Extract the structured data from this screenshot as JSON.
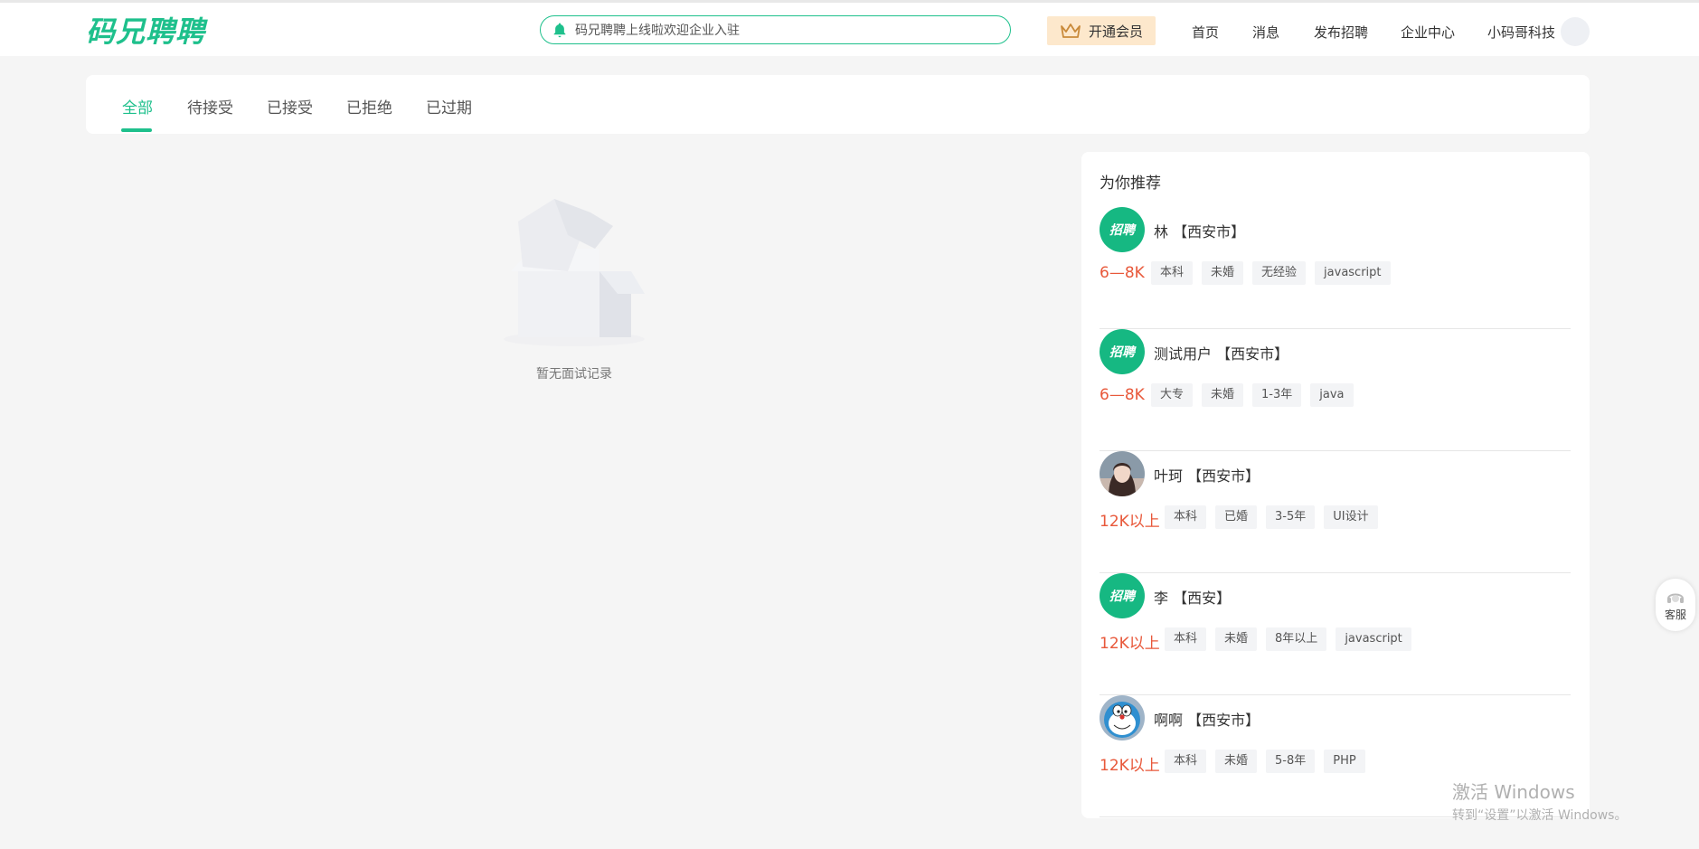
{
  "header": {
    "logo": "码兄聘聘",
    "notice": "码兄聘聘上线啦欢迎企业入驻",
    "vip_label": "开通会员",
    "nav": [
      "首页",
      "消息",
      "发布招聘",
      "企业中心",
      "小码哥科技"
    ]
  },
  "tabs": [
    "全部",
    "待接受",
    "已接受",
    "已拒绝",
    "已过期"
  ],
  "active_tab": "全部",
  "empty_text": "暂无面试记录",
  "recommend": {
    "title": "为你推荐",
    "items": [
      {
        "avatar": "brand",
        "avatar_text": "招聘",
        "name": "林 【西安市】",
        "salary": "6—8K",
        "tags": [
          "本科",
          "未婚",
          "无经验",
          "javascript"
        ]
      },
      {
        "avatar": "brand",
        "avatar_text": "招聘",
        "name": "测试用户 【西安市】",
        "salary": "6—8K",
        "tags": [
          "大专",
          "未婚",
          "1-3年",
          "java"
        ]
      },
      {
        "avatar": "photo-woman",
        "avatar_text": "",
        "name": "叶珂 【西安市】",
        "salary": "12K以上",
        "tags": [
          "本科",
          "已婚",
          "3-5年",
          "UI设计"
        ]
      },
      {
        "avatar": "brand",
        "avatar_text": "招聘",
        "name": "李 【西安】",
        "salary": "12K以上",
        "tags": [
          "本科",
          "未婚",
          "8年以上",
          "javascript"
        ]
      },
      {
        "avatar": "photo-doraemon",
        "avatar_text": "",
        "name": "啊啊 【西安市】",
        "salary": "12K以上",
        "tags": [
          "本科",
          "未婚",
          "5-8年",
          "PHP"
        ]
      }
    ]
  },
  "service_label": "客服",
  "watermark": {
    "line1": "激活 Windows",
    "line2": "转到“设置”以激活 Windows。"
  },
  "colors": {
    "accent": "#1ec08c",
    "salary": "#e8583a",
    "vip_bg": "#fde8cc"
  }
}
